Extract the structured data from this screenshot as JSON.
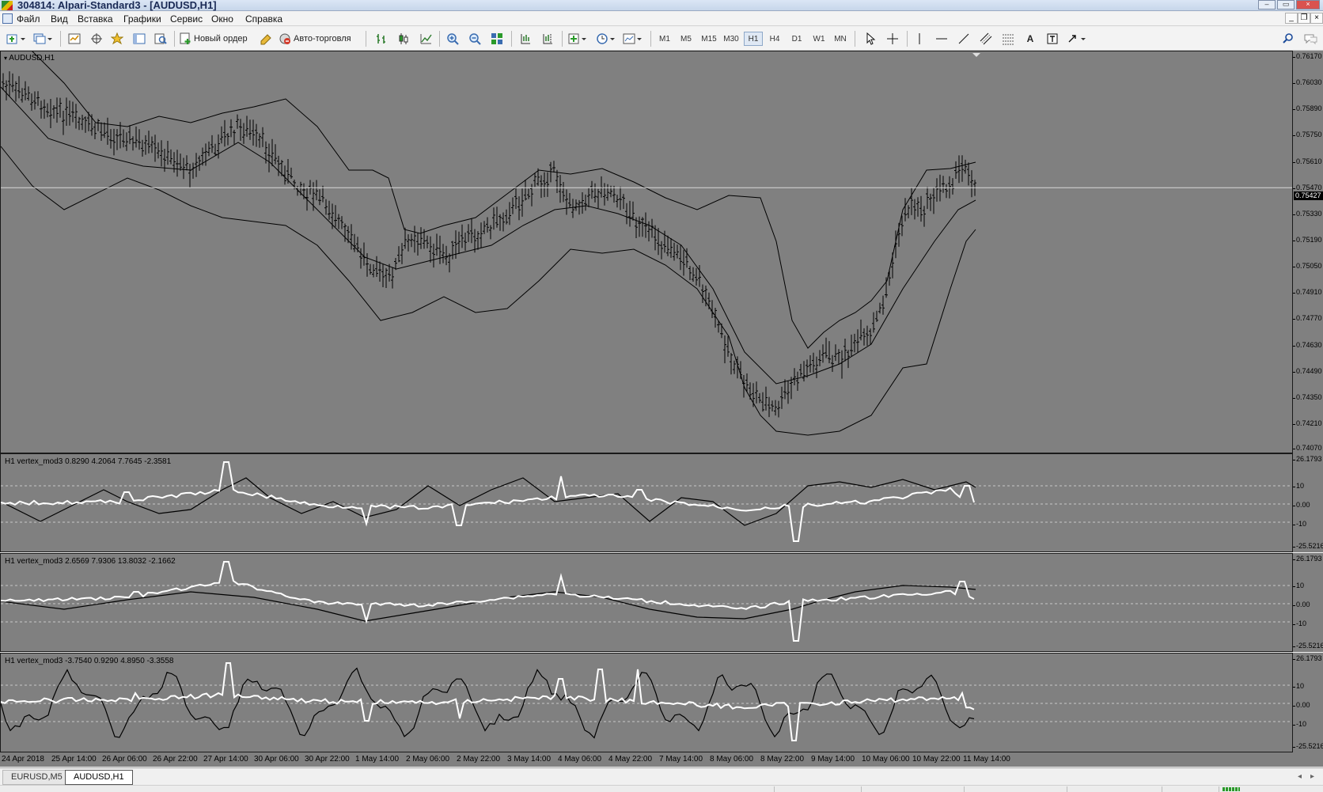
{
  "window": {
    "title": "304814: Alpari-Standard3 - [AUDUSD,H1]"
  },
  "menu": {
    "items": [
      "Файл",
      "Вид",
      "Вставка",
      "Графики",
      "Сервис",
      "Окно",
      "Справка"
    ]
  },
  "toolbar": {
    "new_order": "Новый ордер",
    "auto_trading": "Авто-торговля",
    "timeframes": [
      "M1",
      "M5",
      "M15",
      "M30",
      "H1",
      "H4",
      "D1",
      "W1",
      "MN"
    ],
    "active_timeframe": "H1",
    "icons": [
      "new-chart-icon",
      "profiles-icon",
      "market-watch-icon",
      "navigator-icon",
      "favorites-icon",
      "terminal-icon",
      "strategy-tester-icon",
      "bar-chart-icon",
      "candlesticks-icon",
      "line-chart-icon",
      "zoom-in-icon",
      "zoom-out-icon",
      "tile-windows-icon",
      "auto-scroll-icon",
      "chart-shift-icon",
      "indicators-icon",
      "periods-icon",
      "templates-icon",
      "cursor-icon",
      "crosshair-icon",
      "vertical-line-icon",
      "horizontal-line-icon",
      "trendline-icon",
      "equidistant-channel-icon",
      "fibonacci-icon",
      "text-icon",
      "text-label-icon",
      "arrows-icon",
      "search-icon",
      "chat-icon"
    ]
  },
  "chart": {
    "symbol_label": "AUDUSD,H1",
    "current_price": "0.75427",
    "price_scale": [
      "0.76170",
      "0.76030",
      "0.75890",
      "0.75750",
      "0.75610",
      "0.75470",
      "0.75330",
      "0.75190",
      "0.75050",
      "0.74910",
      "0.74770",
      "0.74630",
      "0.74490",
      "0.74350",
      "0.74210",
      "0.74070"
    ],
    "price_range": [
      0.7407,
      0.7617
    ],
    "colors": {
      "background": "#808080",
      "bars": "#000000",
      "indicator_white": "#ffffff",
      "grid_dash": "#c8c8c8"
    }
  },
  "indicators": [
    {
      "label": "H1 vertex_mod3 0.8290 4.2064 7.7645 -2.3581",
      "scale": [
        "26.1793",
        "10",
        "0.00",
        "-10",
        "-25.5216"
      ]
    },
    {
      "label": "H1 vertex_mod3 2.6569 7.9306 13.8032 -2.1662",
      "scale": [
        "26.1793",
        "10",
        "0.00",
        "-10",
        "-25.5216"
      ]
    },
    {
      "label": "H1 vertex_mod3 -3.7540 0.9290 4.8950 -3.3558",
      "scale": [
        "26.1793",
        "10",
        "0.00",
        "-10",
        "-25.5216"
      ]
    }
  ],
  "time_axis": [
    "24 Apr 2018",
    "25 Apr 14:00",
    "26 Apr 06:00",
    "26 Apr 22:00",
    "27 Apr 14:00",
    "30 Apr 06:00",
    "30 Apr 22:00",
    "1 May 14:00",
    "2 May 06:00",
    "2 May 22:00",
    "3 May 14:00",
    "4 May 06:00",
    "4 May 22:00",
    "7 May 14:00",
    "8 May 06:00",
    "8 May 22:00",
    "9 May 14:00",
    "10 May 06:00",
    "10 May 22:00",
    "11 May 14:00"
  ],
  "tabs": [
    {
      "label": "EURUSD,M5",
      "active": false
    },
    {
      "label": "AUDUSD,H1",
      "active": true
    }
  ]
}
